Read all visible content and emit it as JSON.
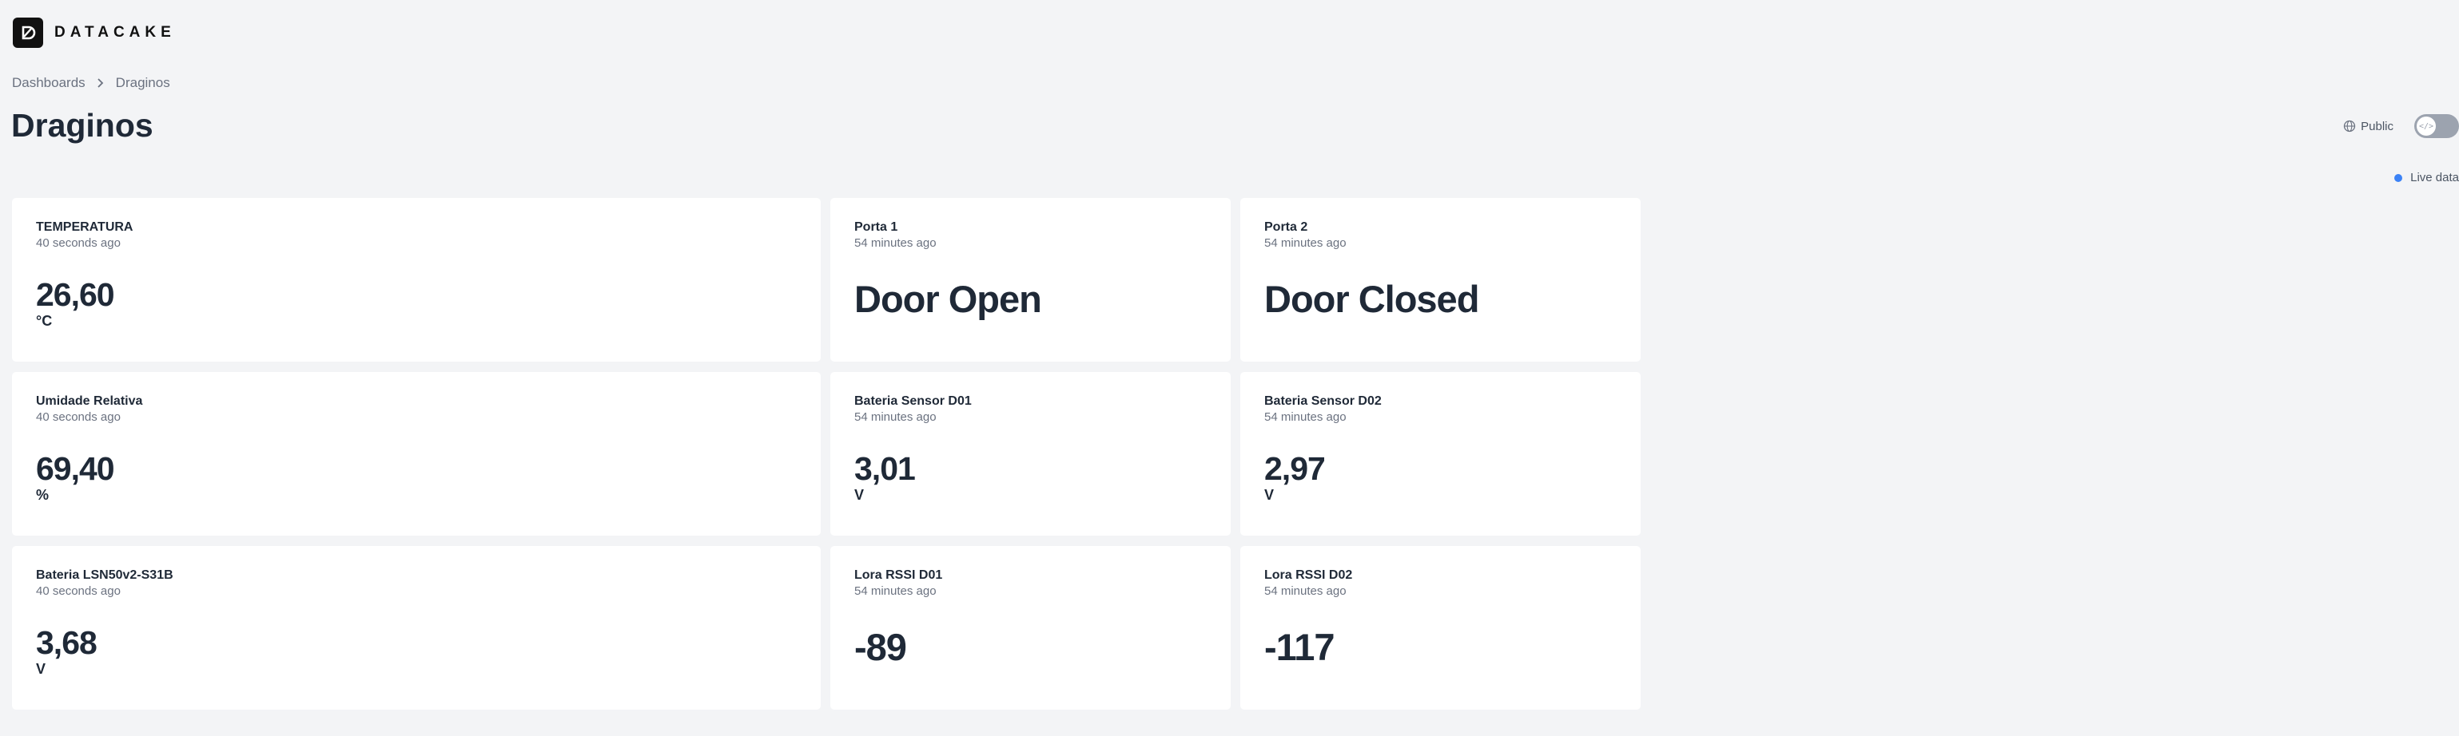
{
  "brand": {
    "name": "DATACAKE",
    "logo_icon": "datacake-logo-icon"
  },
  "breadcrumb": {
    "root": "Dashboards",
    "current": "Draginos"
  },
  "page": {
    "title": "Draginos"
  },
  "controls": {
    "public_label": "Public",
    "toggle_icon_text": "</>",
    "live_data_label": "Live data",
    "live_dot_color": "#3b82f6"
  },
  "widgets": [
    {
      "title": "TEMPERATURA",
      "time": "40 seconds ago",
      "value": "26,60",
      "unit": "°C"
    },
    {
      "title": "Porta 1",
      "time": "54 minutes ago",
      "value": "Door Open",
      "unit": ""
    },
    {
      "title": "Porta 2",
      "time": "54 minutes ago",
      "value": "Door Closed",
      "unit": ""
    },
    {
      "title": "Umidade Relativa",
      "time": "40 seconds ago",
      "value": "69,40",
      "unit": "%"
    },
    {
      "title": "Bateria Sensor D01",
      "time": "54 minutes ago",
      "value": "3,01",
      "unit": "V"
    },
    {
      "title": "Bateria Sensor D02",
      "time": "54 minutes ago",
      "value": "2,97",
      "unit": "V"
    },
    {
      "title": "Bateria LSN50v2-S31B",
      "time": "40 seconds ago",
      "value": "3,68",
      "unit": "V"
    },
    {
      "title": "Lora RSSI D01",
      "time": "54 minutes ago",
      "value": "-89",
      "unit": ""
    },
    {
      "title": "Lora RSSI D02",
      "time": "54 minutes ago",
      "value": "-117",
      "unit": ""
    }
  ]
}
